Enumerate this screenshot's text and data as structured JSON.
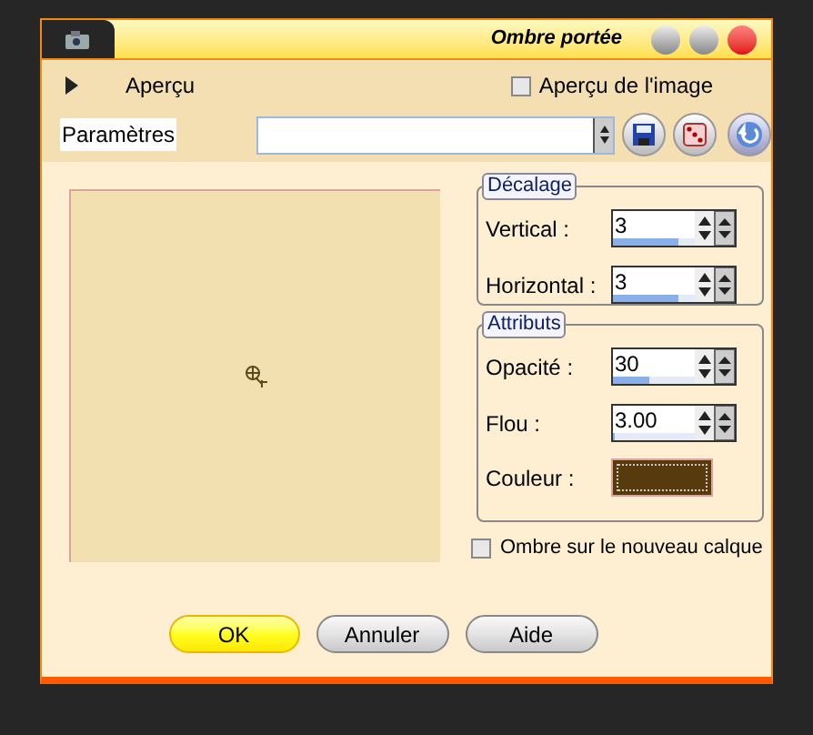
{
  "window": {
    "title": "Ombre portée"
  },
  "preview_toggle": {
    "label": "Aperçu",
    "expanded": false
  },
  "image_preview": {
    "label": "Aperçu de l'image",
    "checked": false
  },
  "presets": {
    "label": "Paramètres"
  },
  "offset_group": {
    "title": "Décalage",
    "fields": [
      {
        "label": "Vertical :",
        "value": "3",
        "level": 0.8
      },
      {
        "label": "Horizontal :",
        "value": "3",
        "level": 0.8
      }
    ]
  },
  "attributes_group": {
    "title": "Attributs",
    "fields": [
      {
        "label": "Opacité :",
        "value": "30",
        "level": 0.45
      },
      {
        "label": "Flou :",
        "value": "3.00",
        "level": 0.03
      }
    ],
    "color": {
      "label": "Couleur :",
      "color": "#573b0c"
    }
  },
  "new_layer": {
    "label": "Ombre sur le nouveau calque",
    "checked": false
  },
  "buttons": [
    {
      "label": "OK",
      "kind": "primary"
    },
    {
      "label": "Annuler",
      "kind": "normal"
    },
    {
      "label": "Aide",
      "kind": "normal"
    }
  ]
}
